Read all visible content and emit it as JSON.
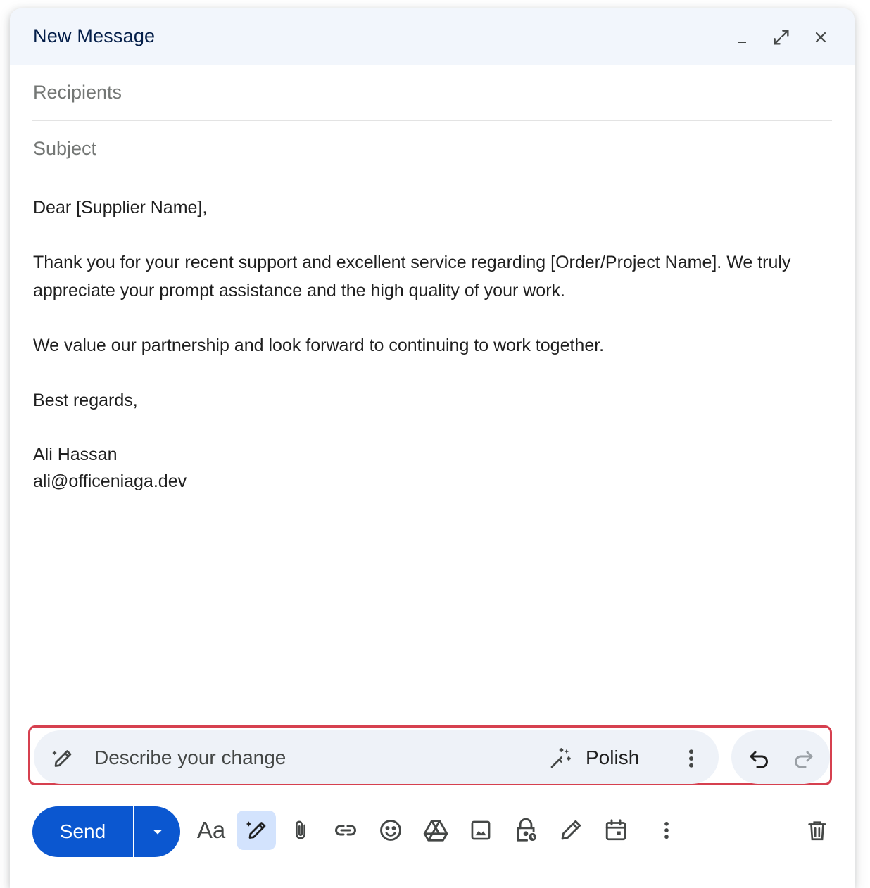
{
  "window": {
    "title": "New Message"
  },
  "fields": {
    "recipients_placeholder": "Recipients",
    "subject_placeholder": "Subject"
  },
  "body": {
    "greeting": "Dear [Supplier Name],",
    "paragraph1": "Thank you for your recent support and excellent service regarding [Order/Project Name]. We truly appreciate your prompt assistance and the high quality of your work.",
    "paragraph2": "We value our partnership and look forward to continuing to work together.",
    "closing": "Best regards,",
    "signature_name": "Ali Hassan",
    "signature_email": "ali@officeniaga.dev"
  },
  "ai_bar": {
    "placeholder": "Describe your change",
    "polish_label": "Polish",
    "highlight_color": "#d6404f"
  },
  "toolbar": {
    "send_label": "Send",
    "format_label": "Aa",
    "send_color": "#0b57d0",
    "icons": [
      "formatting-icon",
      "help-me-write-icon",
      "attach-icon",
      "link-icon",
      "emoji-icon",
      "drive-icon",
      "photo-icon",
      "confidential-mode-icon",
      "signature-icon",
      "schedule-icon",
      "more-options-icon",
      "discard-icon"
    ]
  }
}
